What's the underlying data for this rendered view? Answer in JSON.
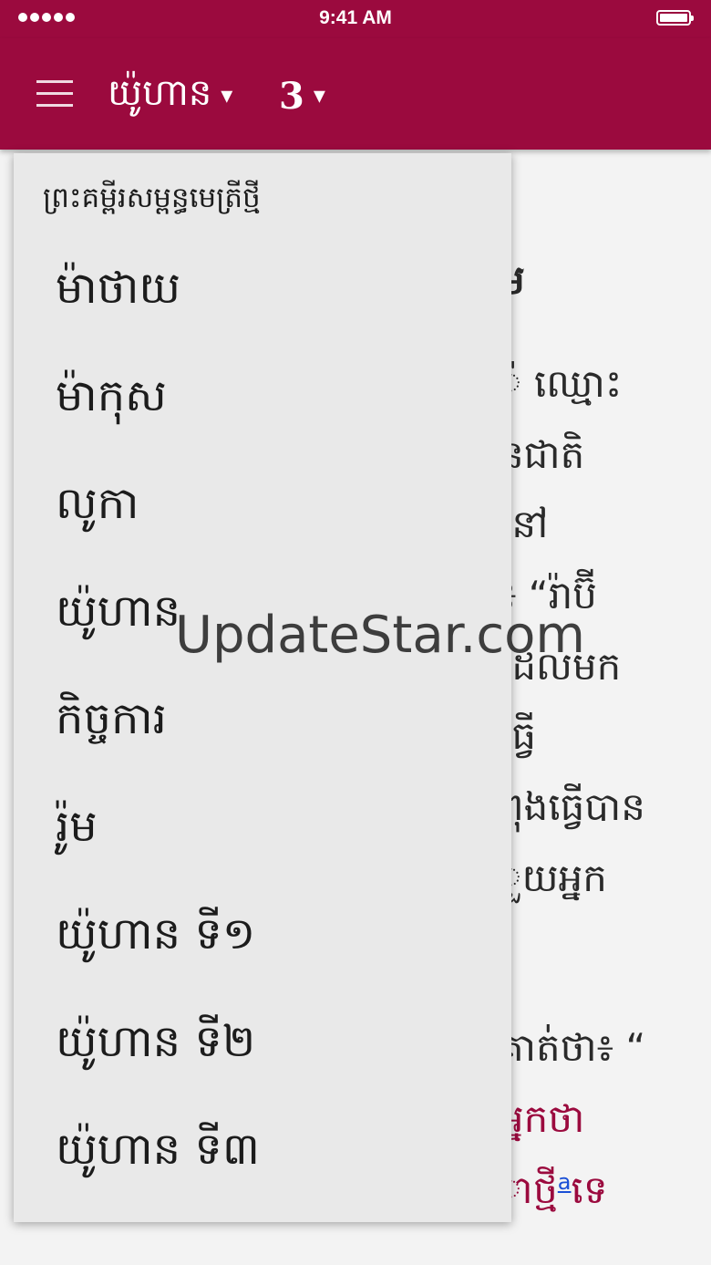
{
  "status_bar": {
    "time": "9:41 AM"
  },
  "header": {
    "book": "យ៉ូហាន",
    "chapter": "3",
    "caret": "▾"
  },
  "content": {
    "fragments": [
      "ម",
      "៉ ឈ្មោះ",
      "នជាតិ",
      "នៅ",
      "៖ “រ៉ាប៊ី",
      "ដែលមក",
      "ធ្វើ",
      "ពុងធ្វើបាន",
      "ួយអ្នក",
      "គាត់ថា៖ “",
      "អ្នកថា",
      "ាថ្មី",
      "ទេ"
    ],
    "footnote": "a"
  },
  "dropdown": {
    "header": "ព្រះគម្ពីរសម្ពន្ធមេត្រីថ្មី",
    "books": [
      "ម៉ាថាយ",
      "ម៉ាកុស",
      "លូកា",
      "យ៉ូហាន",
      "កិច្ចការ",
      "រ៉ូម",
      "យ៉ូហាន ទី១",
      "យ៉ូហាន ទី២",
      "យ៉ូហាន ទី៣"
    ]
  },
  "watermark": "UpdateStar.com",
  "colors": {
    "brand": "#9b0a3e",
    "menu_bg": "#e9e9e9",
    "footnote_link": "#1a4fd6"
  }
}
